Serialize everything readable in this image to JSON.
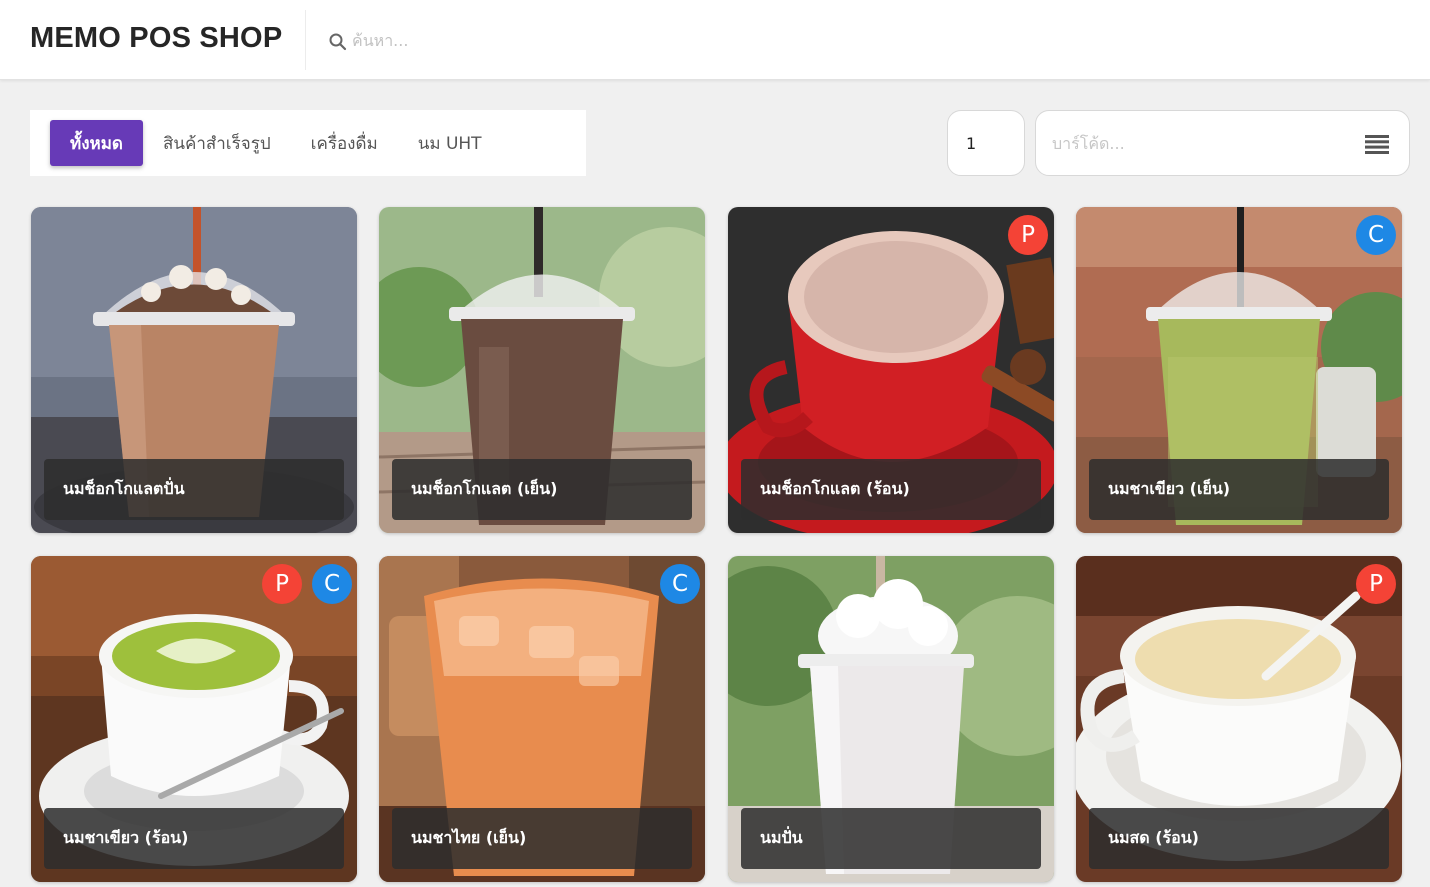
{
  "app": {
    "title": "MEMO POS SHOP"
  },
  "search": {
    "placeholder": "ค้นหา...",
    "icon": "search-icon"
  },
  "categories": [
    {
      "label": "ทั้งหมด",
      "active": true
    },
    {
      "label": "สินค้าสำเร็จรูป",
      "active": false
    },
    {
      "label": "เครื่องดื่ม",
      "active": false
    },
    {
      "label": "นม UHT",
      "active": false
    }
  ],
  "order": {
    "quantity": "1",
    "barcode_placeholder": "บาร์โค้ด...",
    "menu_icon": "list-icon"
  },
  "badge_colors": {
    "P": "#f44336",
    "C": "#1e88e5"
  },
  "accent_color": "#673ab7",
  "products": [
    {
      "name": "นมช็อกโกแลตปั่น",
      "badges": [],
      "photo": "frappe-chocolate"
    },
    {
      "name": "นมช็อกโกแลต (เย็น)",
      "badges": [],
      "photo": "iced-chocolate"
    },
    {
      "name": "นมช็อกโกแลต (ร้อน)",
      "badges": [
        "P"
      ],
      "photo": "hot-chocolate"
    },
    {
      "name": "นมชาเขียว (เย็น)",
      "badges": [
        "C"
      ],
      "photo": "iced-green-tea"
    },
    {
      "name": "นมชาเขียว (ร้อน)",
      "badges": [
        "P",
        "C"
      ],
      "photo": "hot-green-tea"
    },
    {
      "name": "นมชาไทย (เย็น)",
      "badges": [
        "C"
      ],
      "photo": "iced-thai-tea"
    },
    {
      "name": "นมปั่น",
      "badges": [],
      "photo": "milk-frappe"
    },
    {
      "name": "นมสด (ร้อน)",
      "badges": [
        "P"
      ],
      "photo": "hot-milk"
    }
  ]
}
